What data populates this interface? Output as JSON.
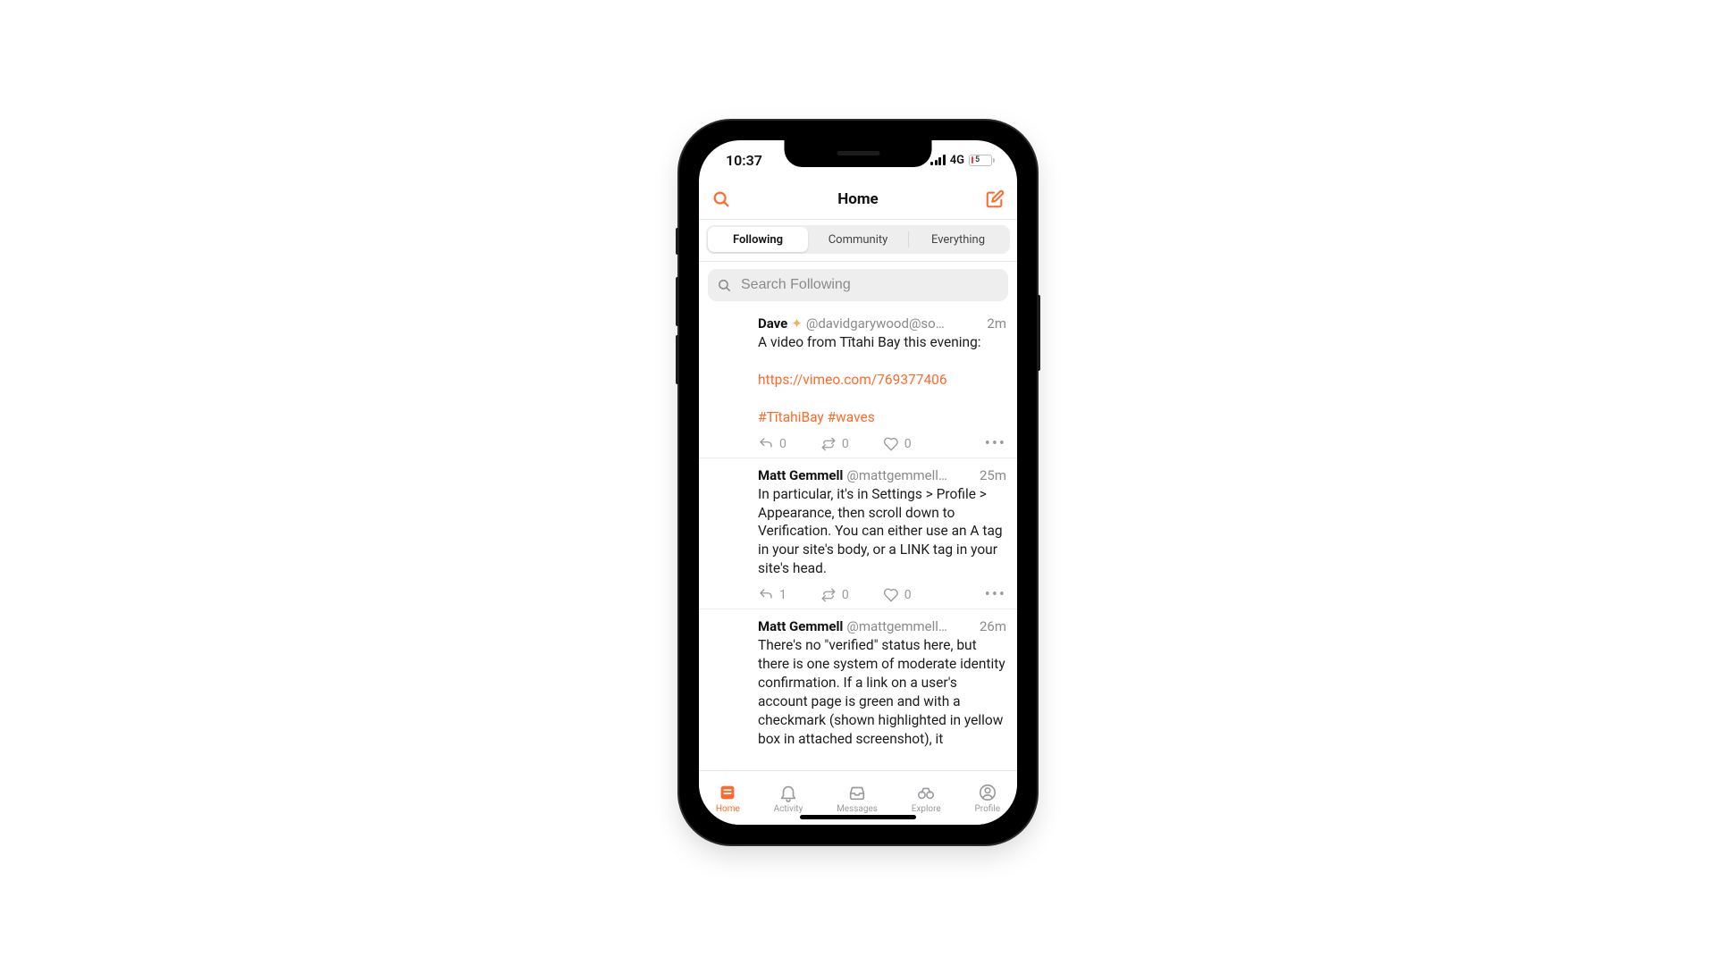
{
  "colors": {
    "accent": "#ff6a2c"
  },
  "statusbar": {
    "time": "10:37",
    "network": "4G",
    "battery_pct": 5
  },
  "navbar": {
    "title": "Home"
  },
  "segments": {
    "items": [
      "Following",
      "Community",
      "Everything"
    ],
    "active_index": 0
  },
  "search": {
    "placeholder": "Search Following"
  },
  "posts": [
    {
      "name": "Dave",
      "badge": "✦",
      "handle": "@davidgarywood@so…",
      "time": "2m",
      "text_line1": "A video from Tītahi Bay this evening:",
      "link": "https://vimeo.com/769377406",
      "tags": "#TītahiBay #waves",
      "replies": "0",
      "boosts": "0",
      "likes": "0"
    },
    {
      "name": "Matt Gemmell",
      "handle": "@mattgemmell…",
      "time": "25m",
      "text": "In particular, it's in Settings > Profile > Appearance, then scroll down to Verification. You can either use an A tag in your site's body, or a LINK tag in your site's head.",
      "replies": "1",
      "boosts": "0",
      "likes": "0"
    },
    {
      "name": "Matt Gemmell",
      "handle": "@mattgemmell…",
      "time": "26m",
      "text": "There's no \"verified\" status here, but there is one system of moderate identity confirmation. If a link on a user's account page is green and with a checkmark (shown highlighted in yellow box in attached screenshot), it"
    }
  ],
  "tabs": {
    "items": [
      {
        "label": "Home"
      },
      {
        "label": "Activity"
      },
      {
        "label": "Messages"
      },
      {
        "label": "Explore"
      },
      {
        "label": "Profile"
      }
    ],
    "active_index": 0
  }
}
